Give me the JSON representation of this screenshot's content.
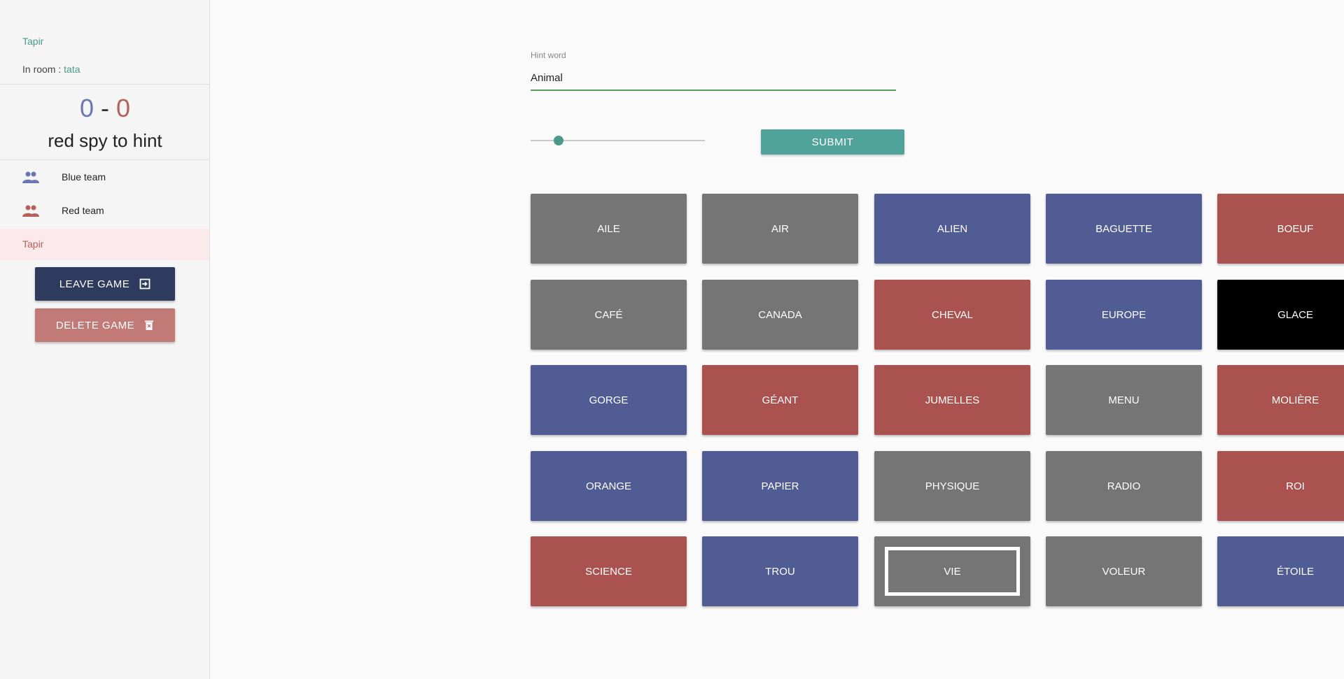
{
  "sidebar": {
    "user_name": "Tapir",
    "room_prefix": "In room : ",
    "room_name": "tata",
    "score": {
      "blue": "0",
      "separator": "-",
      "red": "0"
    },
    "turn_text": "red spy to hint",
    "teams": [
      {
        "label": "Blue team",
        "color": "#6b77b5",
        "icon": "team-icon"
      },
      {
        "label": "Red team",
        "color": "#b5615a",
        "icon": "team-icon"
      }
    ],
    "player": "Tapir",
    "leave_label": "LEAVE GAME",
    "delete_label": "DELETE GAME"
  },
  "hint": {
    "label": "Hint word",
    "value": "Animal",
    "slider_value_fraction": 0.13,
    "submit_label": "SUBMIT"
  },
  "colors": {
    "neutral": "#757575",
    "blue": "#515b94",
    "red": "#a9524f",
    "assassin": "#000000"
  },
  "board": [
    {
      "word": "AILE",
      "color": "neutral"
    },
    {
      "word": "AIR",
      "color": "neutral"
    },
    {
      "word": "ALIEN",
      "color": "blue"
    },
    {
      "word": "BAGUETTE",
      "color": "blue"
    },
    {
      "word": "BOEUF",
      "color": "red"
    },
    {
      "word": "CAFÉ",
      "color": "neutral"
    },
    {
      "word": "CANADA",
      "color": "neutral"
    },
    {
      "word": "CHEVAL",
      "color": "red"
    },
    {
      "word": "EUROPE",
      "color": "blue"
    },
    {
      "word": "GLACE",
      "color": "assassin"
    },
    {
      "word": "GORGE",
      "color": "blue"
    },
    {
      "word": "GÉANT",
      "color": "red"
    },
    {
      "word": "JUMELLES",
      "color": "red"
    },
    {
      "word": "MENU",
      "color": "neutral"
    },
    {
      "word": "MOLIÈRE",
      "color": "red"
    },
    {
      "word": "ORANGE",
      "color": "blue"
    },
    {
      "word": "PAPIER",
      "color": "blue"
    },
    {
      "word": "PHYSIQUE",
      "color": "neutral"
    },
    {
      "word": "RADIO",
      "color": "neutral"
    },
    {
      "word": "ROI",
      "color": "red"
    },
    {
      "word": "SCIENCE",
      "color": "red"
    },
    {
      "word": "TROU",
      "color": "blue"
    },
    {
      "word": "VIE",
      "color": "neutral",
      "selected": true
    },
    {
      "word": "VOLEUR",
      "color": "neutral"
    },
    {
      "word": "ÉTOILE",
      "color": "blue"
    }
  ]
}
